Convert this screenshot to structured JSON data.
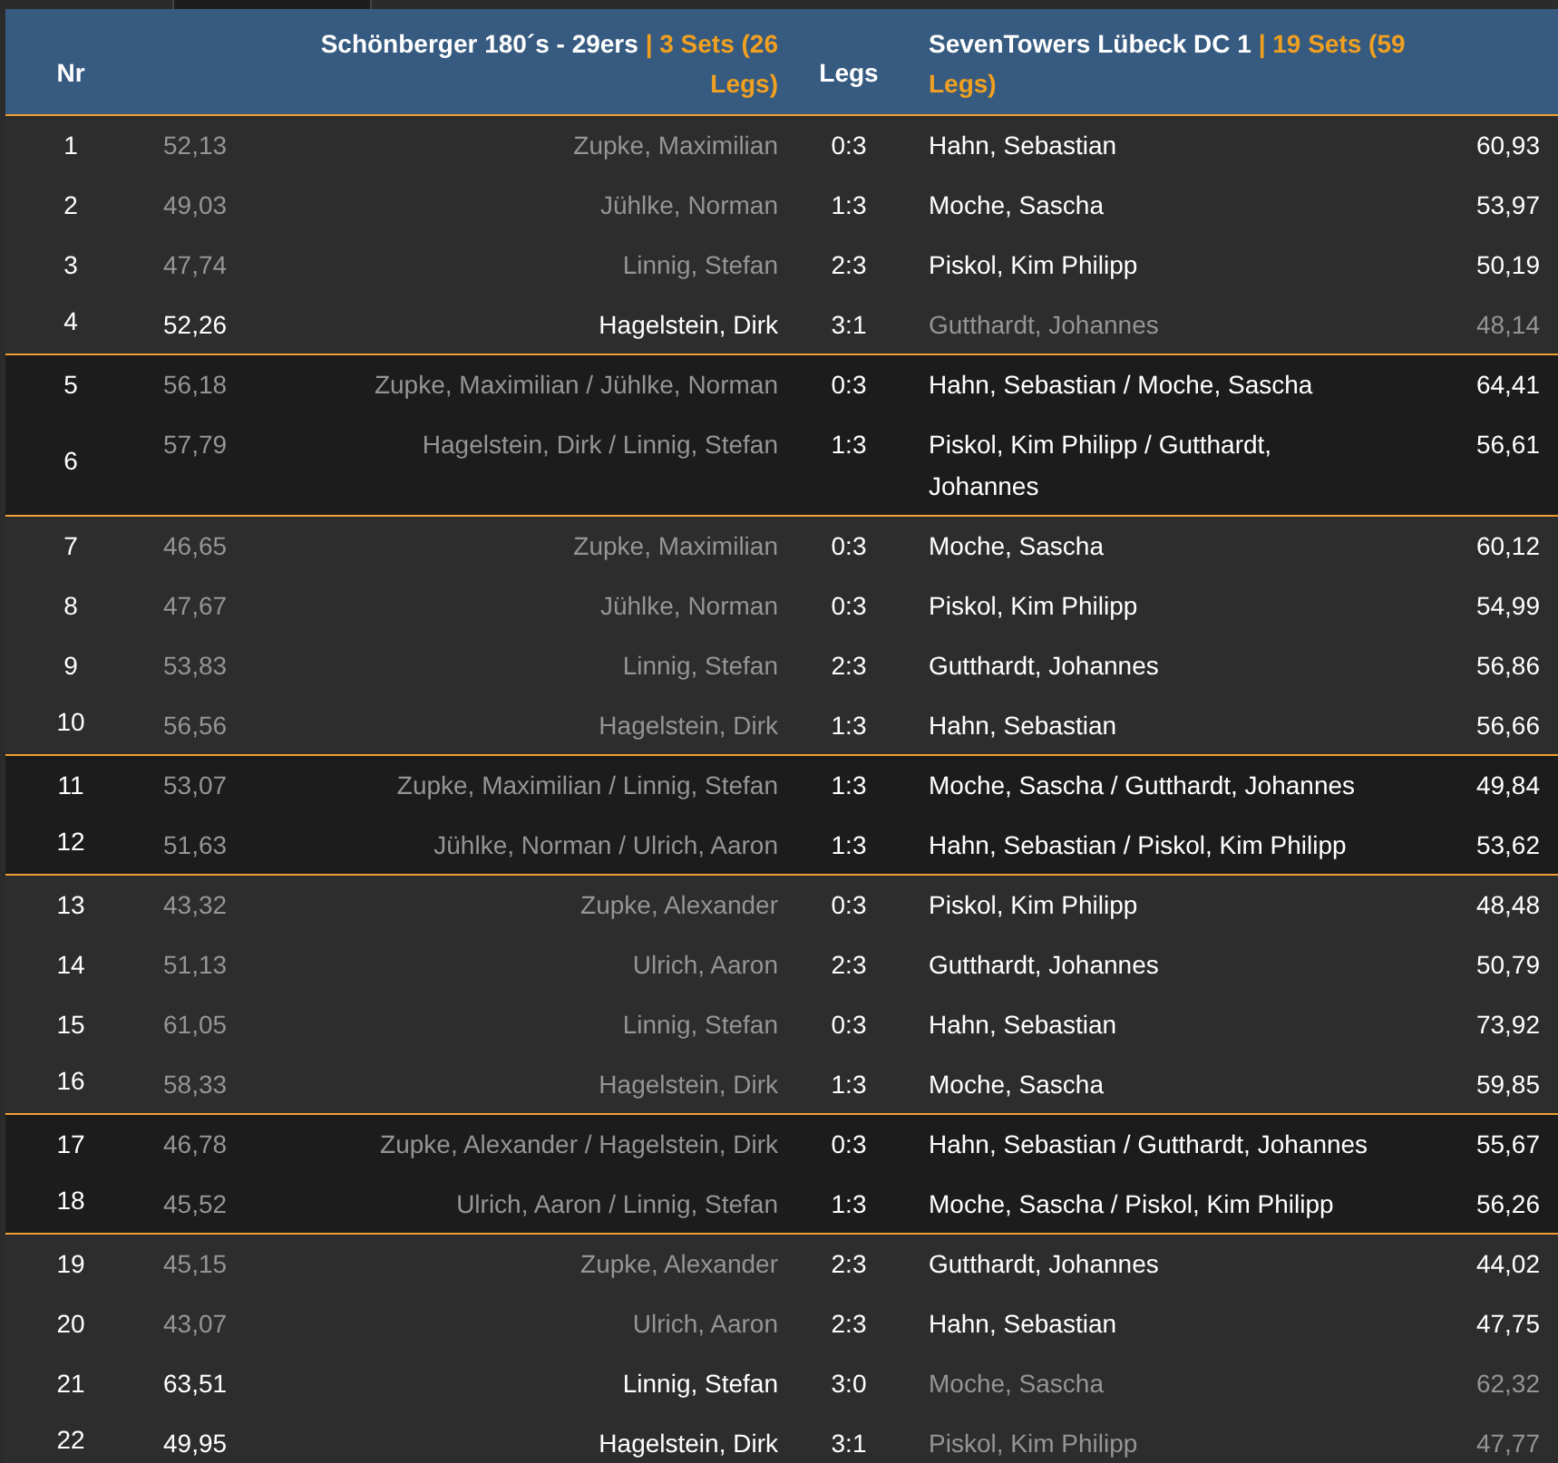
{
  "header": {
    "nr": "Nr",
    "home_team": "Schönberger 180´s - 29ers",
    "home_score": "| 3 Sets (26 Legs)",
    "legs": "Legs",
    "away_team": "SevenTowers Lübeck DC 1",
    "away_score": "| 19 Sets (59 Legs)"
  },
  "groups": [
    {
      "kind": "singles",
      "rows": [
        {
          "nr": "1",
          "home_avg": "52,13",
          "home_player": "Zupke, Maximilian",
          "legs": "0:3",
          "away_player": "Hahn, Sebastian",
          "away_avg": "60,93",
          "home_won": false
        },
        {
          "nr": "2",
          "home_avg": "49,03",
          "home_player": "Jühlke, Norman",
          "legs": "1:3",
          "away_player": "Moche, Sascha",
          "away_avg": "53,97",
          "home_won": false
        },
        {
          "nr": "3",
          "home_avg": "47,74",
          "home_player": "Linnig, Stefan",
          "legs": "2:3",
          "away_player": "Piskol, Kim Philipp",
          "away_avg": "50,19",
          "home_won": false
        },
        {
          "nr": "4",
          "home_avg": "52,26",
          "home_player": "Hagelstein, Dirk",
          "legs": "3:1",
          "away_player": "Gutthardt, Johannes",
          "away_avg": "48,14",
          "home_won": true
        }
      ]
    },
    {
      "kind": "doubles",
      "rows": [
        {
          "nr": "5",
          "home_avg": "56,18",
          "home_player": "Zupke, Maximilian / Jühlke, Norman",
          "legs": "0:3",
          "away_player": "Hahn, Sebastian / Moche, Sascha",
          "away_avg": "64,41",
          "home_won": false
        },
        {
          "nr": "6",
          "home_avg": "57,79",
          "home_player": "Hagelstein, Dirk / Linnig, Stefan",
          "legs": "1:3",
          "away_player": "Piskol, Kim Philipp / Gutthardt, Johannes",
          "away_avg": "56,61",
          "home_won": false
        }
      ]
    },
    {
      "kind": "singles",
      "rows": [
        {
          "nr": "7",
          "home_avg": "46,65",
          "home_player": "Zupke, Maximilian",
          "legs": "0:3",
          "away_player": "Moche, Sascha",
          "away_avg": "60,12",
          "home_won": false
        },
        {
          "nr": "8",
          "home_avg": "47,67",
          "home_player": "Jühlke, Norman",
          "legs": "0:3",
          "away_player": "Piskol, Kim Philipp",
          "away_avg": "54,99",
          "home_won": false
        },
        {
          "nr": "9",
          "home_avg": "53,83",
          "home_player": "Linnig, Stefan",
          "legs": "2:3",
          "away_player": "Gutthardt, Johannes",
          "away_avg": "56,86",
          "home_won": false
        },
        {
          "nr": "10",
          "home_avg": "56,56",
          "home_player": "Hagelstein, Dirk",
          "legs": "1:3",
          "away_player": "Hahn, Sebastian",
          "away_avg": "56,66",
          "home_won": false
        }
      ]
    },
    {
      "kind": "doubles",
      "rows": [
        {
          "nr": "11",
          "home_avg": "53,07",
          "home_player": "Zupke, Maximilian / Linnig, Stefan",
          "legs": "1:3",
          "away_player": "Moche, Sascha / Gutthardt, Johannes",
          "away_avg": "49,84",
          "home_won": false
        },
        {
          "nr": "12",
          "home_avg": "51,63",
          "home_player": "Jühlke, Norman / Ulrich, Aaron",
          "legs": "1:3",
          "away_player": "Hahn, Sebastian / Piskol, Kim Philipp",
          "away_avg": "53,62",
          "home_won": false
        }
      ]
    },
    {
      "kind": "singles",
      "rows": [
        {
          "nr": "13",
          "home_avg": "43,32",
          "home_player": "Zupke, Alexander",
          "legs": "0:3",
          "away_player": "Piskol, Kim Philipp",
          "away_avg": "48,48",
          "home_won": false
        },
        {
          "nr": "14",
          "home_avg": "51,13",
          "home_player": "Ulrich, Aaron",
          "legs": "2:3",
          "away_player": "Gutthardt, Johannes",
          "away_avg": "50,79",
          "home_won": false
        },
        {
          "nr": "15",
          "home_avg": "61,05",
          "home_player": "Linnig, Stefan",
          "legs": "0:3",
          "away_player": "Hahn, Sebastian",
          "away_avg": "73,92",
          "home_won": false
        },
        {
          "nr": "16",
          "home_avg": "58,33",
          "home_player": "Hagelstein, Dirk",
          "legs": "1:3",
          "away_player": "Moche, Sascha",
          "away_avg": "59,85",
          "home_won": false
        }
      ]
    },
    {
      "kind": "doubles",
      "rows": [
        {
          "nr": "17",
          "home_avg": "46,78",
          "home_player": "Zupke, Alexander / Hagelstein, Dirk",
          "legs": "0:3",
          "away_player": "Hahn, Sebastian / Gutthardt, Johannes",
          "away_avg": "55,67",
          "home_won": false
        },
        {
          "nr": "18",
          "home_avg": "45,52",
          "home_player": "Ulrich, Aaron / Linnig, Stefan",
          "legs": "1:3",
          "away_player": "Moche, Sascha / Piskol, Kim Philipp",
          "away_avg": "56,26",
          "home_won": false
        }
      ]
    },
    {
      "kind": "singles",
      "rows": [
        {
          "nr": "19",
          "home_avg": "45,15",
          "home_player": "Zupke, Alexander",
          "legs": "2:3",
          "away_player": "Gutthardt, Johannes",
          "away_avg": "44,02",
          "home_won": false
        },
        {
          "nr": "20",
          "home_avg": "43,07",
          "home_player": "Ulrich, Aaron",
          "legs": "2:3",
          "away_player": "Hahn, Sebastian",
          "away_avg": "47,75",
          "home_won": false
        },
        {
          "nr": "21",
          "home_avg": "63,51",
          "home_player": "Linnig, Stefan",
          "legs": "3:0",
          "away_player": "Moche, Sascha",
          "away_avg": "62,32",
          "home_won": true
        },
        {
          "nr": "22",
          "home_avg": "49,95",
          "home_player": "Hagelstein, Dirk",
          "legs": "3:1",
          "away_player": "Piskol, Kim Philipp",
          "away_avg": "47,77",
          "home_won": true
        }
      ]
    }
  ]
}
